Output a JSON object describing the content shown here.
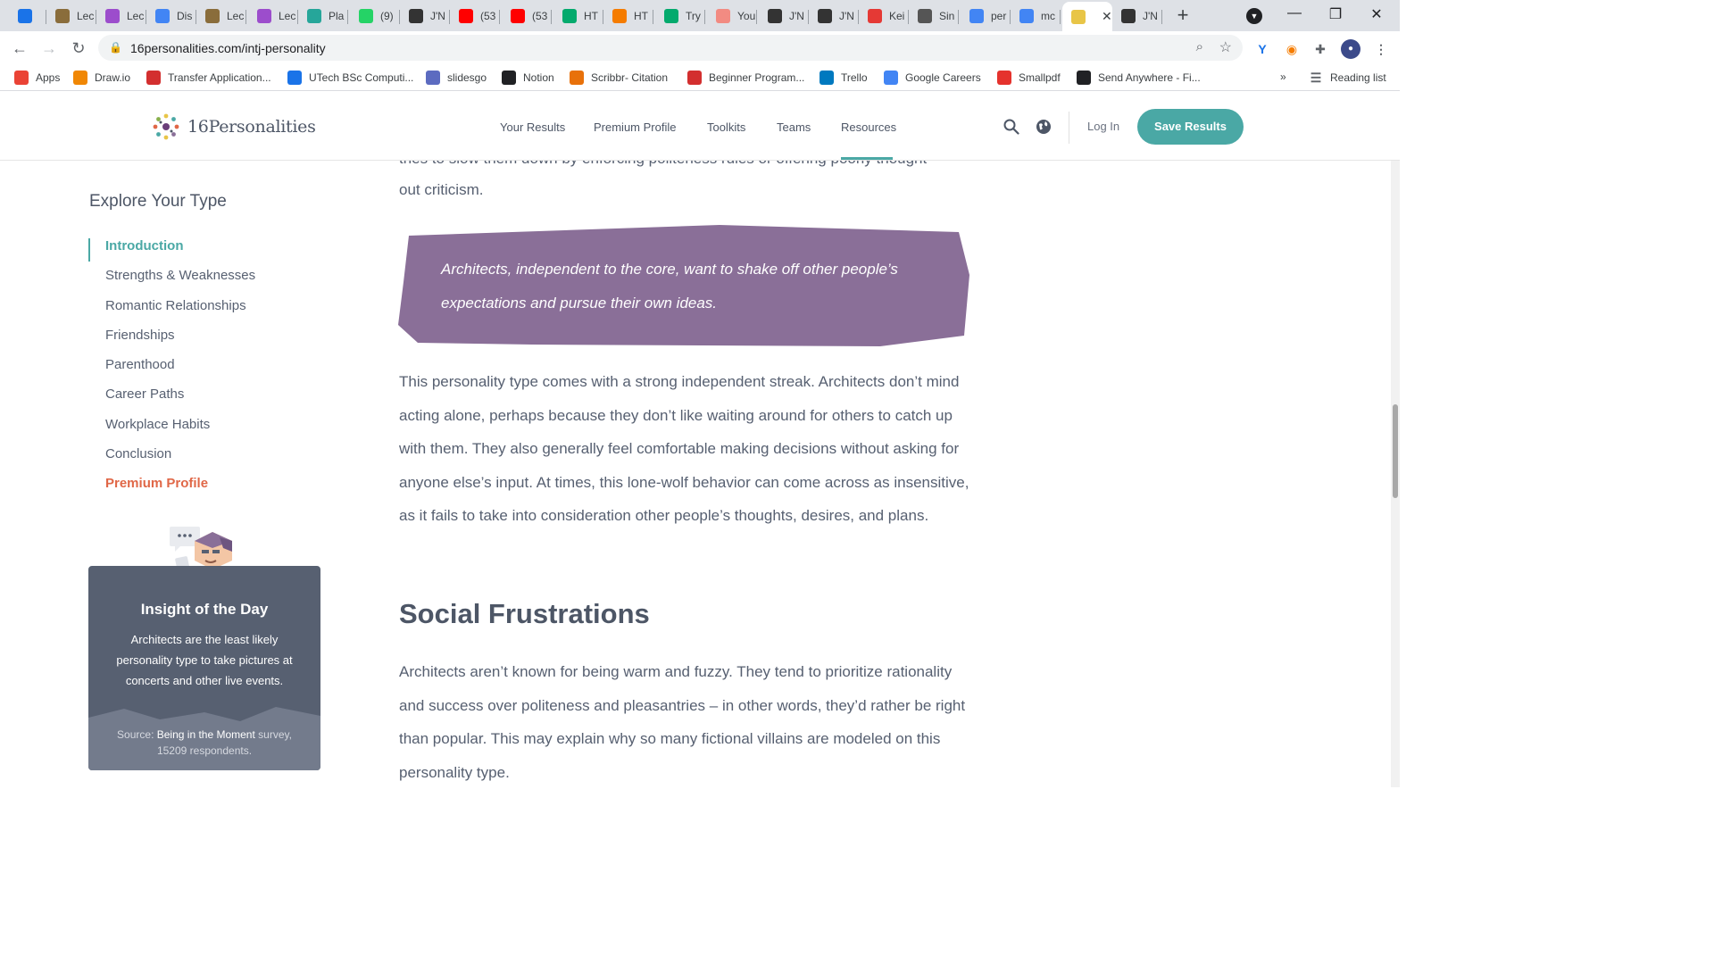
{
  "browser": {
    "tabs": [
      {
        "label": "",
        "icon": "shield-y-icon",
        "color": "#1a73e8"
      },
      {
        "label": "Lec",
        "icon": "lightbulb-icon",
        "color": "#8a6d3b"
      },
      {
        "label": "Lec",
        "icon": "video-icon",
        "color": "#9c4dcc"
      },
      {
        "label": "Dis",
        "icon": "doc-icon",
        "color": "#4285f4"
      },
      {
        "label": "Lec",
        "icon": "lightbulb-icon",
        "color": "#8a6d3b"
      },
      {
        "label": "Lec",
        "icon": "video-icon",
        "color": "#9c4dcc"
      },
      {
        "label": "Pla",
        "icon": "c-icon",
        "color": "#26a69a"
      },
      {
        "label": "(9)",
        "icon": "whatsapp-icon",
        "color": "#25d366"
      },
      {
        "label": "J'N",
        "icon": "butterfly-icon",
        "color": "#333333"
      },
      {
        "label": "(53",
        "icon": "youtube-icon",
        "color": "#ff0000"
      },
      {
        "label": "(53",
        "icon": "youtube-icon",
        "color": "#ff0000"
      },
      {
        "label": "HT",
        "icon": "w3-icon",
        "color": "#04aa6d"
      },
      {
        "label": "HT",
        "icon": "search-q-icon",
        "color": "#f57c00"
      },
      {
        "label": "Try",
        "icon": "w3-icon",
        "color": "#04aa6d"
      },
      {
        "label": "You",
        "icon": "youtube-outline-icon",
        "color": "#f28b82"
      },
      {
        "label": "J'N",
        "icon": "butterfly-icon",
        "color": "#333333"
      },
      {
        "label": "J'N",
        "icon": "butterfly-icon",
        "color": "#333333"
      },
      {
        "label": "Kei",
        "icon": "color-wheel-icon",
        "color": "#e53935"
      },
      {
        "label": "Sin",
        "icon": "barcode-icon",
        "color": "#555555"
      },
      {
        "label": "per",
        "icon": "google-icon",
        "color": "#4285f4"
      },
      {
        "label": "mc",
        "icon": "google-icon",
        "color": "#4285f4"
      },
      {
        "label": "",
        "icon": "16p-icon",
        "color": "#e8c547"
      },
      {
        "label": "J'N",
        "icon": "butterfly-icon",
        "color": "#333333"
      }
    ],
    "url": "16personalities.com/intj-personality",
    "bookmarks": [
      {
        "label": "Apps",
        "icon": "apps-grid-icon",
        "color": "#ea4335"
      },
      {
        "label": "Draw.io",
        "icon": "drawio-icon",
        "color": "#f08705"
      },
      {
        "label": "Transfer Application...",
        "icon": "uwi-icon",
        "color": "#d32f2f"
      },
      {
        "label": "UTech BSc Computi...",
        "icon": "people-icon",
        "color": "#1a73e8"
      },
      {
        "label": "slidesgo",
        "icon": "slidesgo-icon",
        "color": "#5c6bc0"
      },
      {
        "label": "Notion",
        "icon": "check-icon",
        "color": "#202124"
      },
      {
        "label": "Scribbr- Citation",
        "icon": "scribbr-icon",
        "color": "#e8710a"
      },
      {
        "label": "Beginner Program...",
        "icon": "hub-icon",
        "color": "#d32f2f"
      },
      {
        "label": "Trello",
        "icon": "trello-icon",
        "color": "#0079bf"
      },
      {
        "label": "Google Careers",
        "icon": "google-icon",
        "color": "#4285f4"
      },
      {
        "label": "Smallpdf",
        "icon": "smallpdf-icon",
        "color": "#e5322d"
      },
      {
        "label": "Send Anywhere - Fi...",
        "icon": "send-anywhere-icon",
        "color": "#202124"
      }
    ],
    "bookmarks_more": "»",
    "reading_list": "Reading list"
  },
  "site": {
    "logo_text": "16Personalities",
    "nav": [
      "Your Results",
      "Premium Profile",
      "Toolkits",
      "Teams",
      "Resources"
    ],
    "login": "Log In",
    "save_button": "Save Results",
    "accent": "#4aa8a5"
  },
  "sidebar": {
    "title": "Explore Your Type",
    "items": [
      {
        "label": "Introduction",
        "state": "active"
      },
      {
        "label": "Strengths & Weaknesses",
        "state": "normal"
      },
      {
        "label": "Romantic Relationships",
        "state": "normal"
      },
      {
        "label": "Friendships",
        "state": "normal"
      },
      {
        "label": "Parenthood",
        "state": "normal"
      },
      {
        "label": "Career Paths",
        "state": "normal"
      },
      {
        "label": "Workplace Habits",
        "state": "normal"
      },
      {
        "label": "Conclusion",
        "state": "normal"
      },
      {
        "label": "Premium Profile",
        "state": "premium"
      }
    ],
    "insight": {
      "title": "Insight of the Day",
      "text": "Architects are the least likely personality type to take pictures at concerts and other live events.",
      "source_prefix": "Source: ",
      "source_link": "Being in the Moment",
      "source_suffix": " survey, 15209 respondents."
    }
  },
  "article": {
    "partial_top": "tries to slow them down by enforcing politeness rules or offering poorly thought",
    "partial_line": "out criticism.",
    "quote": "Architects, independent to the core, want to shake off other people’s expectations and pursue their own ideas.",
    "paragraph1": "This personality type comes with a strong independent streak. Architects don’t mind acting alone, perhaps because they don’t like waiting around for others to catch up with them. They also generally feel comfortable making decisions without asking for anyone else’s input. At times, this lone-wolf behavior can come across as insensitive, as it fails to take into consideration other people’s thoughts, desires, and plans.",
    "section_title": "Social Frustrations",
    "paragraph2": "Architects aren’t known for being warm and fuzzy. They tend to prioritize rationality and success over politeness and pleasantries – in other words, they’d rather be right than popular. This may explain why so many fictional villains are modeled on this personality type.",
    "quote_color": "#8a6f98"
  }
}
